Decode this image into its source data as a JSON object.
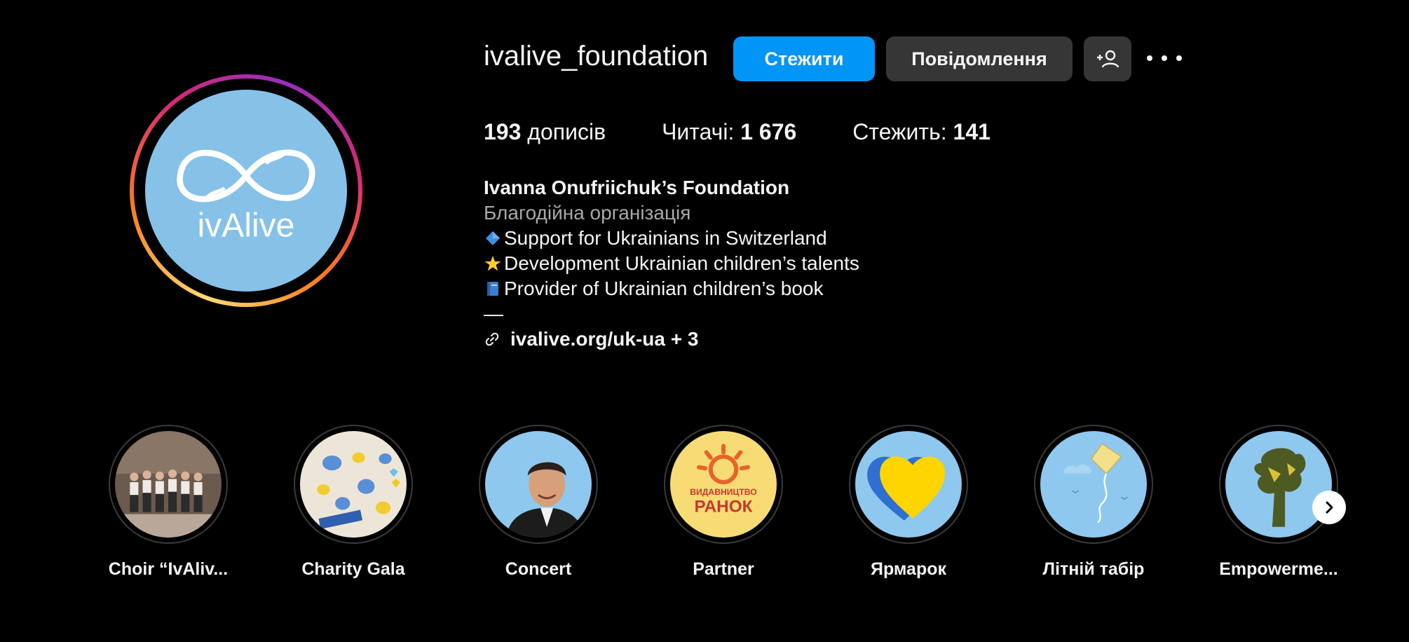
{
  "profile": {
    "username": "ivalive_foundation",
    "avatar_text": "ivAlive",
    "buttons": {
      "follow": "Стежити",
      "message": "Повідомлення"
    },
    "stats": {
      "posts_count": "193",
      "posts_label": "дописів",
      "followers_label": "Читачі:",
      "followers_count": "1 676",
      "following_label": "Стежить:",
      "following_count": "141"
    },
    "bio": {
      "name": "Ivanna Onufriichuk’s Foundation",
      "category": "Благодійна організація",
      "lines": [
        "Support for Ukrainians in Switzerland",
        "Development Ukrainian children’s talents",
        "Provider of Ukrainian children’s book"
      ],
      "separator": "—",
      "link": "ivalive.org/uk-ua + 3"
    }
  },
  "icons": {
    "add_user": "add-user-icon",
    "more": "more-options-icon",
    "link": "link-icon",
    "next": "chevron-right-icon",
    "bio_emojis": [
      "blue-diamond-icon",
      "star-icon",
      "blue-book-icon"
    ]
  },
  "highlights": [
    {
      "label": "Choir “IvAliv..."
    },
    {
      "label": "Charity Gala"
    },
    {
      "label": "Concert"
    },
    {
      "label": "Partner",
      "image_text_1": "ВИДАВНИЦТВО",
      "image_text_2": "РАНОК"
    },
    {
      "label": "Ярмарок"
    },
    {
      "label": "Літній табір"
    },
    {
      "label": "Empowerme..."
    }
  ],
  "colors": {
    "background": "#000000",
    "follow_button": "#0095f6",
    "secondary_button": "#363636",
    "avatar_bg": "#86c1e8",
    "muted_text": "#a8a8a8"
  }
}
